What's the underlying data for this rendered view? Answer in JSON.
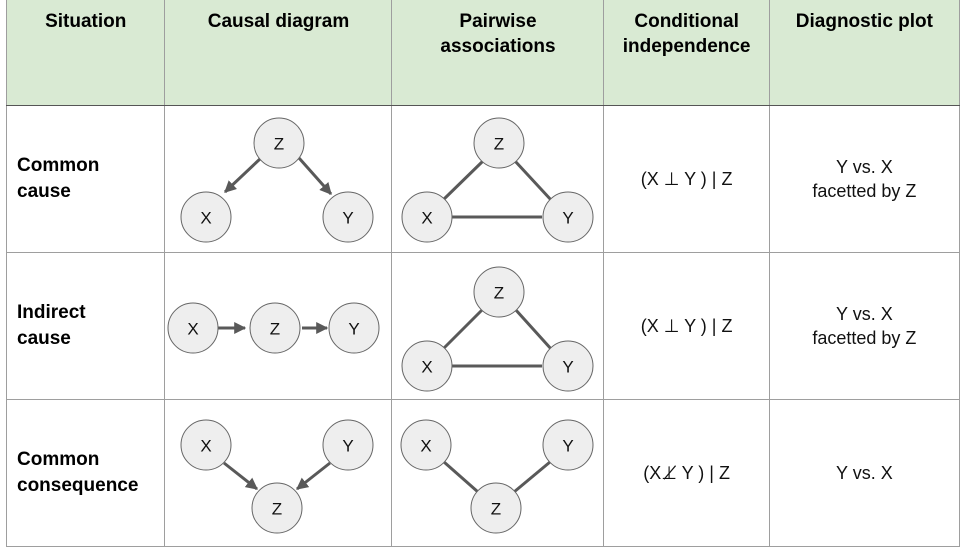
{
  "header": {
    "situation": "Situation",
    "causal_diagram": "Causal diagram",
    "pairwise_1": "Pairwise",
    "pairwise_2": "associations",
    "cond_1": "Conditional",
    "cond_2": "independence",
    "diagnostic": "Diagnostic plot"
  },
  "rows": [
    {
      "situation_1": "Common",
      "situation_2": "cause",
      "causal_edges": [
        "Z->X",
        "Z->Y"
      ],
      "pairwise_edges": [
        "Z-X",
        "Z-Y",
        "X-Y"
      ],
      "cond_independence": "(X ⊥ Y ) | Z",
      "diagnostic_1": "Y vs. X",
      "diagnostic_2": "facetted by Z"
    },
    {
      "situation_1": "Indirect",
      "situation_2": "cause",
      "causal_edges": [
        "X->Z",
        "Z->Y"
      ],
      "pairwise_edges": [
        "Z-X",
        "Z-Y",
        "X-Y"
      ],
      "cond_independence": "(X ⊥ Y ) | Z",
      "diagnostic_1": "Y vs. X",
      "diagnostic_2": "facetted by Z"
    },
    {
      "situation_1": "Common",
      "situation_2": "consequence",
      "causal_edges": [
        "X->Z",
        "Y->Z"
      ],
      "pairwise_edges": [
        "X-Z",
        "Y-Z"
      ],
      "cond_independence": "(X⊥̸ Y ) | Z",
      "diagnostic_1": "Y vs. X",
      "diagnostic_2": ""
    }
  ],
  "nodes": {
    "x": "X",
    "y": "Y",
    "z": "Z"
  }
}
